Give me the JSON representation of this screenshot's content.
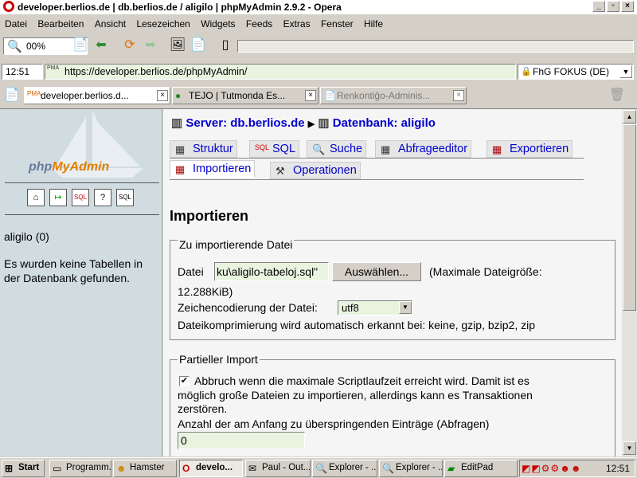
{
  "window": {
    "title": "developer.berlios.de | db.berlios.de / aligilo | phpMyAdmin 2.9.2 - Opera"
  },
  "menu": [
    "Datei",
    "Bearbeiten",
    "Ansicht",
    "Lesezeichen",
    "Widgets",
    "Feeds",
    "Extras",
    "Fenster",
    "Hilfe"
  ],
  "toolbar": {
    "zoom_value": "00%"
  },
  "addressbar": {
    "clock": "12:51",
    "url": "https://developer.berlios.de/phpMyAdmin/",
    "location": "FhG FOKUS (DE)"
  },
  "tabs": [
    {
      "label": "developer.berlios.d..."
    },
    {
      "label": "TEJO | Tutmonda Es..."
    },
    {
      "label": "Renkontiĝo-Adminis..."
    }
  ],
  "sidebar": {
    "logo": "phpMyAdmin",
    "db_name": "aligilo (0)",
    "no_tables": "Es wurden keine Tabellen in der Datenbank gefunden."
  },
  "breadcrumb": {
    "server": "Server: db.berlios.de",
    "database": "Datenbank: aligilo"
  },
  "page_tabs": [
    "Struktur",
    "SQL",
    "Suche",
    "Abfrageeditor",
    "Exportieren",
    "Importieren",
    "Operationen"
  ],
  "page": {
    "heading": "Importieren",
    "file_section": {
      "legend": "Zu importierende Datei",
      "file_label": "Datei",
      "file_value": "ku\\aligilo-tabeloj.sql\"",
      "browse_button": "Auswählen...",
      "max_size_1": "(Maximale Dateigröße:",
      "max_size_2": "12.288KiB)",
      "charset_label": "Zeichencodierung der Datei:",
      "charset_value": "utf8",
      "compression_text": "Dateikomprimierung wird automatisch erkannt bei: keine, gzip, bzip2, zip"
    },
    "partial_section": {
      "legend": "Partieller Import",
      "abort_line1": "Abbruch wenn die maximale Scriptlaufzeit erreicht wird. Damit ist es",
      "abort_line2": "möglich große Dateien zu importieren, allerdings kann es Transaktionen",
      "abort_line3": "zerstören.",
      "skip_label": "Anzahl der am Anfang zu überspringenden Einträge (Abfragen)",
      "skip_value": "0"
    }
  },
  "taskbar": {
    "start": "Start",
    "items": [
      "Programm...",
      "Hamster",
      "develo...",
      "Paul - Out...",
      "Explorer - ...",
      "Explorer - ...",
      "EditPad"
    ],
    "clock": "12:51"
  }
}
